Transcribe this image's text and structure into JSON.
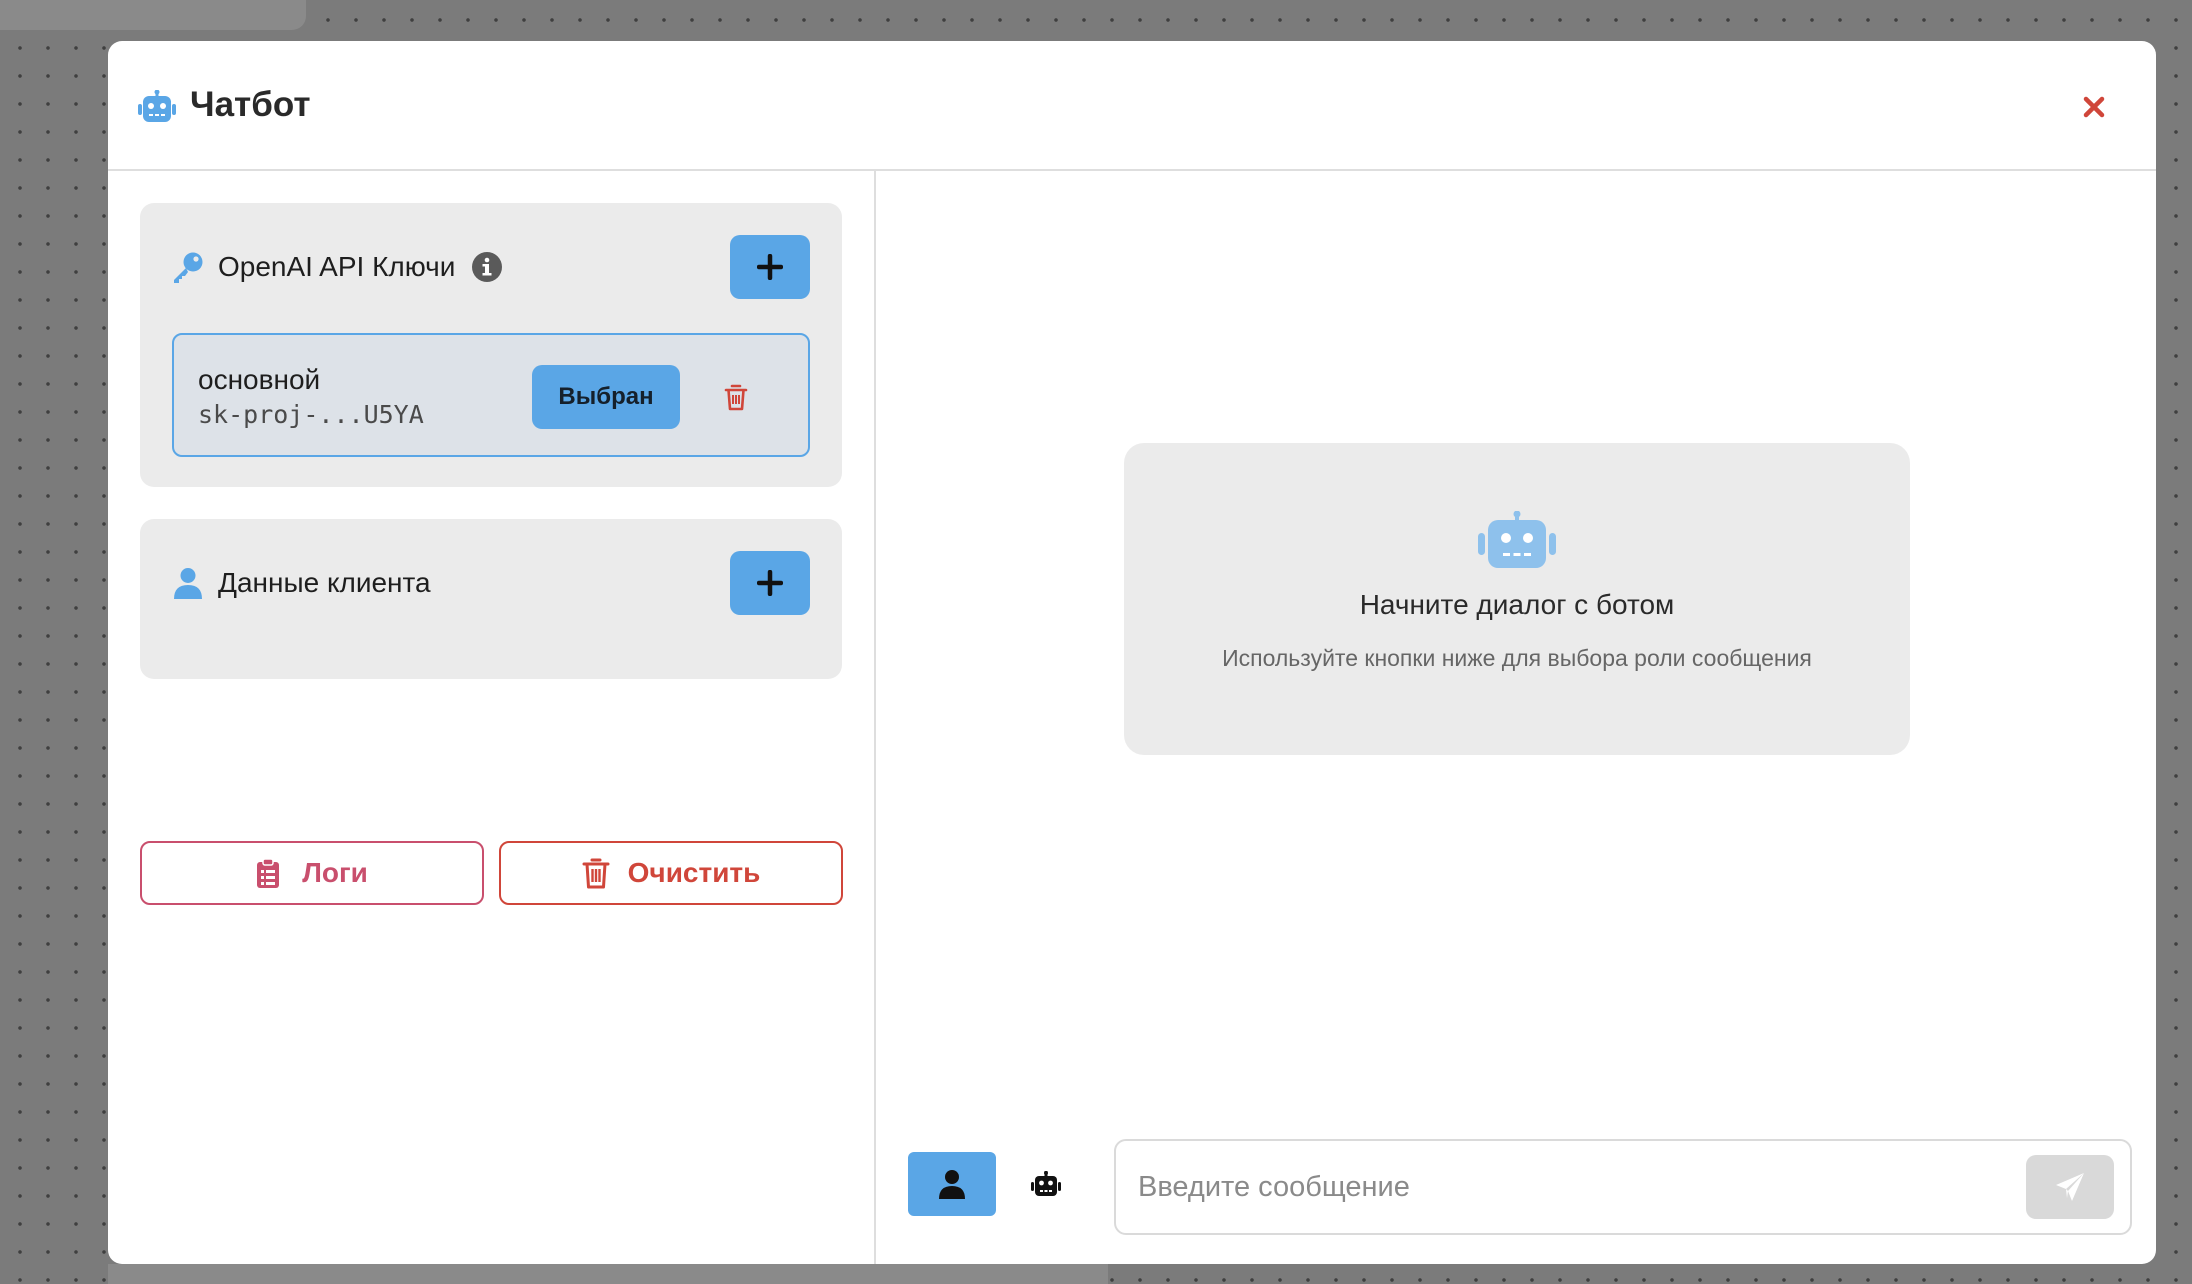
{
  "modal": {
    "title": "Чатбот",
    "close_icon": "close-icon"
  },
  "sidebar": {
    "api_keys": {
      "title": "OpenAI API Ключи",
      "icon": "key-icon",
      "items": [
        {
          "name": "основной",
          "value": "sk-proj-...U5YA",
          "button_label": "Выбран"
        }
      ]
    },
    "client_data": {
      "title": "Данные клиента",
      "icon": "user-icon"
    },
    "logs_label": "Логи",
    "clear_label": "Очистить"
  },
  "chat": {
    "empty_title": "Начните диалог с ботом",
    "empty_subtitle": "Используйте кнопки ниже для выбора роли сообщения",
    "input_placeholder": "Введите сообщение",
    "active_role": "user"
  },
  "colors": {
    "accent": "#5aa6e6",
    "danger": "#d0463a",
    "logs": "#c94f6d",
    "panel_bg": "#ebebeb"
  }
}
